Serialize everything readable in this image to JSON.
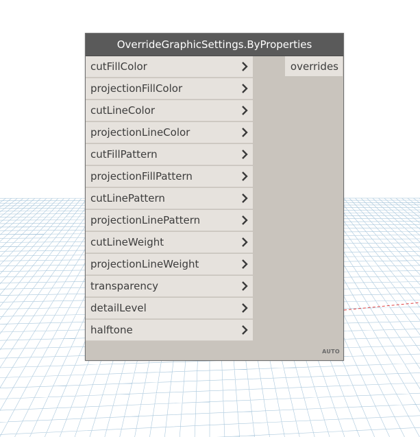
{
  "node": {
    "title": "OverrideGraphicSettings.ByProperties",
    "inputs": [
      {
        "label": "cutFillColor"
      },
      {
        "label": "projectionFillColor"
      },
      {
        "label": "cutLineColor"
      },
      {
        "label": "projectionLineColor"
      },
      {
        "label": "cutFillPattern"
      },
      {
        "label": "projectionFillPattern"
      },
      {
        "label": "cutLinePattern"
      },
      {
        "label": "projectionLinePattern"
      },
      {
        "label": "cutLineWeight"
      },
      {
        "label": "projectionLineWeight"
      },
      {
        "label": "transparency"
      },
      {
        "label": "detailLevel"
      },
      {
        "label": "halftone"
      }
    ],
    "output": {
      "label": "overrides"
    },
    "lacing": "AUTO"
  },
  "colors": {
    "header": "#5a5a5a",
    "body": "#c9c4bd",
    "port": "#e6e2dd",
    "grid": "#9fbfd6",
    "axis_red": "#e04040"
  },
  "icons": {
    "port_chevron": "chevron-right-icon"
  }
}
